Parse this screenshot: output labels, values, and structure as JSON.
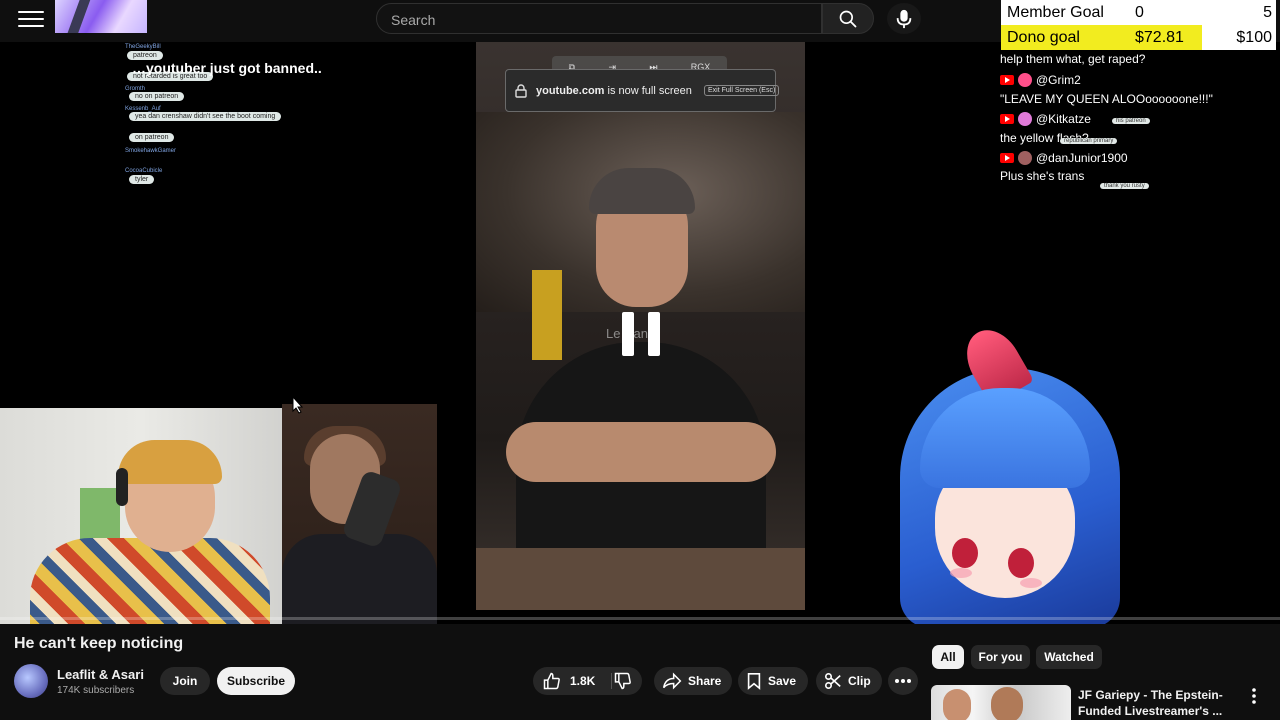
{
  "header": {
    "search_placeholder": "Search"
  },
  "stream": {
    "left_overlay_headline": "…youtuber just got banned..",
    "left_chat_chips": [
      "patreon",
      "not retarded is great too",
      "no on patreon",
      "yea dan crenshaw didn't see the boot coming",
      "on patreon",
      "tyler"
    ],
    "left_chat_names": [
      "TheGeekyBill",
      "Gromth",
      "Kessenb_Auf",
      "SmokehawkGamer",
      "CocoaCubicle"
    ],
    "fullscreen_toast": {
      "domain": "youtube.com",
      "message": " is now full screen",
      "exit_label": "Exit Full Screen (Esc)"
    },
    "fs_toolbar_label": "RGX",
    "center_watermark": "Le…an",
    "goal_panel": {
      "member_goal_label": "Member Goal",
      "member_goal_current": "0",
      "member_goal_target": "5",
      "dono_goal_label": "Dono goal",
      "dono_goal_current": "$72.81",
      "dono_goal_target": "$100",
      "dono_goal_progress": 0.73
    },
    "right_chat": {
      "lines": [
        {
          "kind": "text",
          "text": "help them what, get raped?"
        },
        {
          "kind": "user",
          "name": "@Grim2",
          "avatar_color": "#ff4f8a"
        },
        {
          "kind": "text",
          "text": "\"LEAVE MY QUEEN ALOOoooooone!!!\""
        },
        {
          "kind": "user",
          "name": "@Kitkatze",
          "avatar_color": "#e07ad8"
        },
        {
          "kind": "text",
          "text": "the yellow flash?"
        },
        {
          "kind": "user",
          "name": "@danJunior1900",
          "avatar_color": "#a06060"
        },
        {
          "kind": "text",
          "text": "Plus she's trans"
        }
      ],
      "tags": [
        "his patreon",
        "republican primary",
        "thank you rusty"
      ]
    }
  },
  "video": {
    "title": "He can't keep noticing",
    "channel_name": "Leaflit & Asari",
    "subscribers": "174K subscribers",
    "join_label": "Join",
    "subscribe_label": "Subscribe",
    "like_count": "1.8K",
    "share_label": "Share",
    "save_label": "Save",
    "clip_label": "Clip"
  },
  "sidebar": {
    "filter_chips": [
      "All",
      "For you",
      "Watched"
    ],
    "active_chip": "All",
    "recommendation_title": "JF Gariepy - The Epstein-Funded Livestreamer's ..."
  },
  "colors": {
    "background": "#0f0f0f",
    "dono_fill": "#f2ec1f",
    "youtube_red": "#ff0000"
  },
  "icons": [
    "menu-icon",
    "search-icon",
    "mic-icon",
    "pause-icon",
    "lock-icon",
    "like-icon",
    "dislike-icon",
    "share-icon",
    "save-icon",
    "scissors-icon",
    "more-icon",
    "chevron-up-icon",
    "miniplayer-icon",
    "captions-icon",
    "settings-icon",
    "theater-icon",
    "fullscreen-icon"
  ]
}
